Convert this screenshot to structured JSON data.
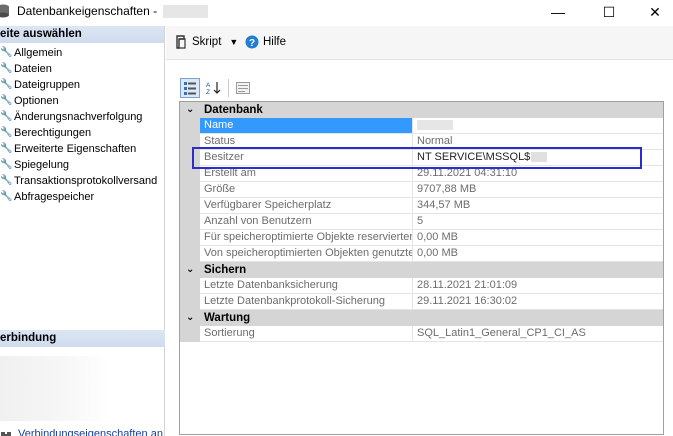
{
  "window": {
    "title": "Datenbankeigenschaften -",
    "controls": {
      "minimize": "—",
      "maximize": "☐",
      "close": "✕"
    }
  },
  "left_panel": {
    "header": "eite auswählen",
    "items": [
      {
        "label": "Allgemein",
        "selected": true
      },
      {
        "label": "Dateien"
      },
      {
        "label": "Dateigruppen"
      },
      {
        "label": "Optionen"
      },
      {
        "label": "Änderungsnachverfolgung"
      },
      {
        "label": "Berechtigungen"
      },
      {
        "label": "Erweiterte Eigenschaften"
      },
      {
        "label": "Spiegelung"
      },
      {
        "label": "Transaktionsprotokollversand"
      },
      {
        "label": "Abfragespeicher"
      }
    ],
    "connection_header": "erbindung",
    "connection_link": "Verbindungseigenschaften an"
  },
  "toolbar": {
    "script_label": "Skript",
    "help_label": "Hilfe"
  },
  "property_grid": {
    "categories": [
      {
        "name": "Datenbank",
        "rows": [
          {
            "name": "Name",
            "value": ""
          },
          {
            "name": "Status",
            "value": "Normal"
          },
          {
            "name": "Besitzer",
            "value": "NT SERVICE\\MSSQL$"
          },
          {
            "name": "Erstellt am",
            "value": "29.11.2021 04:31:10"
          },
          {
            "name": "Größe",
            "value": "9707,88 MB"
          },
          {
            "name": "Verfügbarer Speicherplatz",
            "value": "344,57 MB"
          },
          {
            "name": "Anzahl von Benutzern",
            "value": "5"
          },
          {
            "name": "Für speicheroptimierte Objekte reservierter A",
            "value": "0,00 MB"
          },
          {
            "name": "Von speicheroptimierten Objekten genutzter",
            "value": "0,00 MB"
          }
        ]
      },
      {
        "name": "Sichern",
        "rows": [
          {
            "name": "Letzte Datenbanksicherung",
            "value": "28.11.2021 21:01:09"
          },
          {
            "name": "Letzte Datenbankprotokoll-Sicherung",
            "value": "29.11.2021 16:30:02"
          }
        ]
      },
      {
        "name": "Wartung",
        "rows": [
          {
            "name": "Sortierung",
            "value": "SQL_Latin1_General_CP1_CI_AS"
          }
        ]
      }
    ]
  },
  "colors": {
    "selection": "#3399ff",
    "highlight_box": "#2c2cc8",
    "category_bg": "#d5d5d5",
    "link": "#1a3e9c"
  }
}
